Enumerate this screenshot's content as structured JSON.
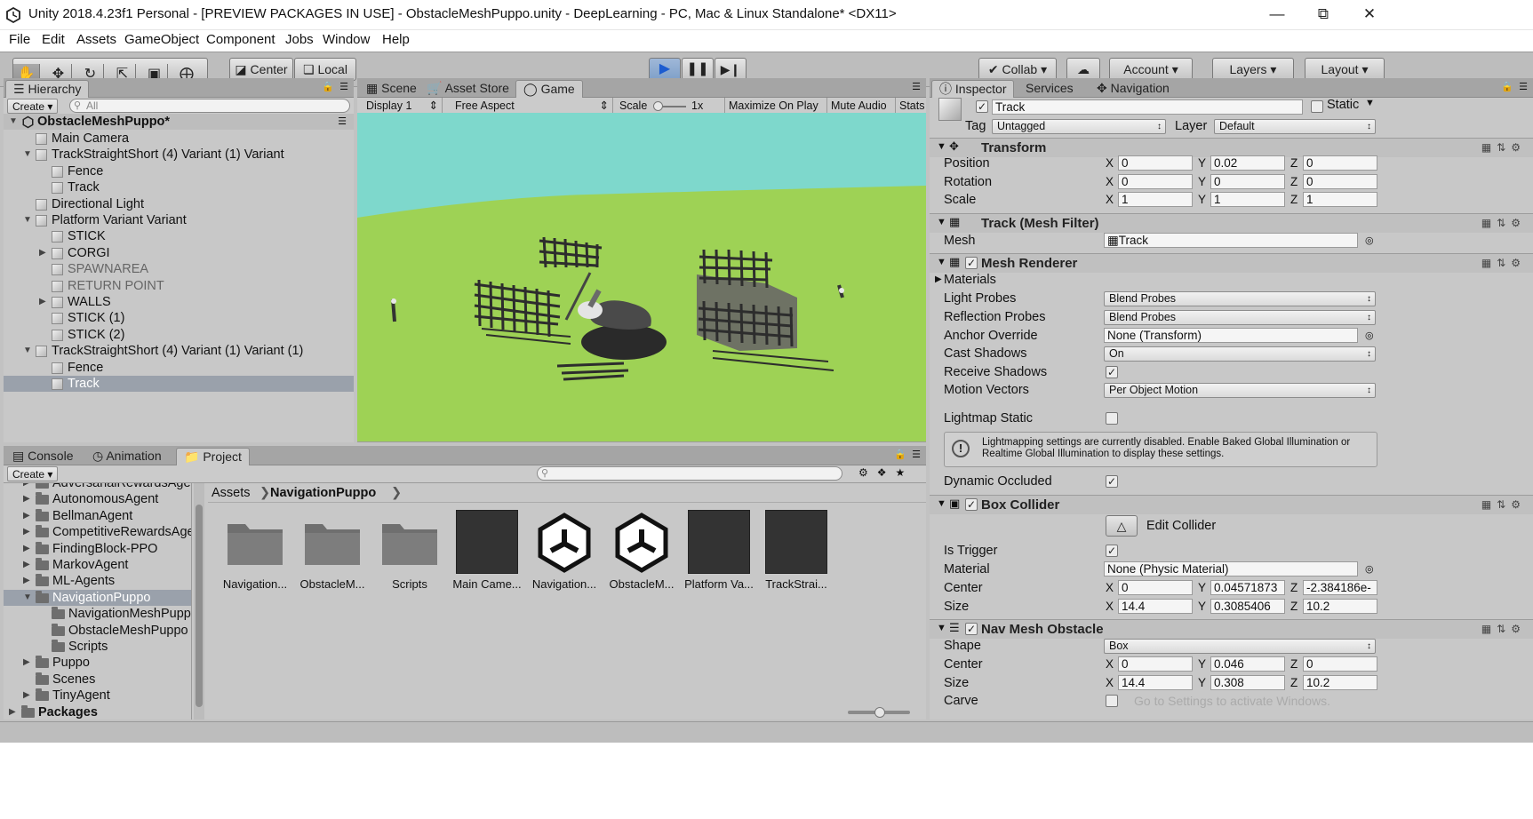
{
  "window": {
    "title": "Unity 2018.4.23f1 Personal - [PREVIEW PACKAGES IN USE] - ObstacleMeshPuppo.unity - DeepLearning - PC, Mac & Linux Standalone* <DX11>",
    "minimize": "—",
    "maximize": "⧉",
    "close": "✕"
  },
  "menu": [
    "File",
    "Edit",
    "Assets",
    "GameObject",
    "Component",
    "Jobs",
    "Window",
    "Help"
  ],
  "toolbar": {
    "tools": [
      "hand-icon",
      "move-icon",
      "rotate-icon",
      "scale-icon",
      "rect-icon",
      "transform-icon"
    ],
    "pivot": "Center",
    "space": "Local",
    "collab": "Collab",
    "account": "Account",
    "layers": "Layers",
    "layout": "Layout"
  },
  "hierarchy": {
    "tab": "Hierarchy",
    "create": "Create",
    "search_placeholder": "All",
    "scene_name": "ObstacleMeshPuppo*",
    "items": [
      {
        "label": "Main Camera",
        "depth": 1,
        "arrow": ""
      },
      {
        "label": "TrackStraightShort (4) Variant (1) Variant",
        "depth": 1,
        "arrow": "down"
      },
      {
        "label": "Fence",
        "depth": 2,
        "arrow": ""
      },
      {
        "label": "Track",
        "depth": 2,
        "arrow": ""
      },
      {
        "label": "Directional Light",
        "depth": 1,
        "arrow": ""
      },
      {
        "label": "Platform Variant Variant",
        "depth": 1,
        "arrow": "down"
      },
      {
        "label": "STICK",
        "depth": 2,
        "arrow": ""
      },
      {
        "label": "CORGI",
        "depth": 2,
        "arrow": "right"
      },
      {
        "label": "SPAWNAREA",
        "depth": 2,
        "arrow": "",
        "faded": true
      },
      {
        "label": "RETURN POINT",
        "depth": 2,
        "arrow": "",
        "faded": true
      },
      {
        "label": "WALLS",
        "depth": 2,
        "arrow": "right"
      },
      {
        "label": "STICK (1)",
        "depth": 2,
        "arrow": ""
      },
      {
        "label": "STICK (2)",
        "depth": 2,
        "arrow": ""
      },
      {
        "label": "TrackStraightShort (4) Variant (1) Variant (1)",
        "depth": 1,
        "arrow": "down"
      },
      {
        "label": "Fence",
        "depth": 2,
        "arrow": ""
      },
      {
        "label": "Track",
        "depth": 2,
        "arrow": "",
        "selected": true
      }
    ]
  },
  "view_tabs": {
    "scene": "Scene",
    "asset_store": "Asset Store",
    "game": "Game",
    "display": "Display 1",
    "aspect": "Free Aspect",
    "scale_label": "Scale",
    "scale_value": "1x",
    "maximize_on_play": "Maximize On Play",
    "mute_audio": "Mute Audio",
    "stats": "Stats"
  },
  "inspector": {
    "tabs": [
      "Inspector",
      "Services",
      "Navigation"
    ],
    "object_name": "Track",
    "static_label": "Static",
    "tag_label": "Tag",
    "tag_value": "Untagged",
    "layer_label": "Layer",
    "layer_value": "Default",
    "transform": {
      "title": "Transform",
      "position_label": "Position",
      "position": [
        "0",
        "0.02",
        "0"
      ],
      "rotation_label": "Rotation",
      "rotation": [
        "0",
        "0",
        "0"
      ],
      "scale_label": "Scale",
      "scale": [
        "1",
        "1",
        "1"
      ]
    },
    "mesh_filter": {
      "title": "Track (Mesh Filter)",
      "mesh_label": "Mesh",
      "mesh_value": "Track"
    },
    "mesh_renderer": {
      "title": "Mesh Renderer",
      "materials": "Materials",
      "light_probes_label": "Light Probes",
      "light_probes": "Blend Probes",
      "reflection_probes_label": "Reflection Probes",
      "reflection_probes": "Blend Probes",
      "anchor_override_label": "Anchor Override",
      "anchor_override": "None (Transform)",
      "cast_shadows_label": "Cast Shadows",
      "cast_shadows": "On",
      "receive_shadows_label": "Receive Shadows",
      "motion_vectors_label": "Motion Vectors",
      "motion_vectors": "Per Object Motion",
      "lightmap_static_label": "Lightmap Static",
      "info": "Lightmapping settings are currently disabled. Enable Baked Global Illumination or Realtime Global Illumination to display these settings.",
      "dynamic_occluded_label": "Dynamic Occluded"
    },
    "box_collider": {
      "title": "Box Collider",
      "edit_collider": "Edit Collider",
      "is_trigger_label": "Is Trigger",
      "material_label": "Material",
      "material": "None (Physic Material)",
      "center_label": "Center",
      "center": [
        "0",
        "0.04571873",
        "-2.384186e-"
      ],
      "size_label": "Size",
      "size": [
        "14.4",
        "0.3085406",
        "10.2"
      ]
    },
    "nav_mesh_obstacle": {
      "title": "Nav Mesh Obstacle",
      "shape_label": "Shape",
      "shape": "Box",
      "center_label": "Center",
      "center": [
        "0",
        "0.046",
        "0"
      ],
      "size_label": "Size",
      "size": [
        "14.4",
        "0.308",
        "10.2"
      ],
      "carve_label": "Carve"
    },
    "axes": [
      "X",
      "Y",
      "Z"
    ],
    "watermark": "Go to Settings to activate Windows."
  },
  "bottom_tabs": {
    "console": "Console",
    "animation": "Animation",
    "project": "Project"
  },
  "project": {
    "create": "Create",
    "tree": [
      {
        "label": "AdversarialRewardsAge",
        "depth": 1,
        "arrow": "right"
      },
      {
        "label": "AutonomousAgent",
        "depth": 1,
        "arrow": "right"
      },
      {
        "label": "BellmanAgent",
        "depth": 1,
        "arrow": "right"
      },
      {
        "label": "CompetitiveRewardsAge",
        "depth": 1,
        "arrow": "right"
      },
      {
        "label": "FindingBlock-PPO",
        "depth": 1,
        "arrow": "right"
      },
      {
        "label": "MarkovAgent",
        "depth": 1,
        "arrow": "right"
      },
      {
        "label": "ML-Agents",
        "depth": 1,
        "arrow": "right"
      },
      {
        "label": "NavigationPuppo",
        "depth": 1,
        "arrow": "down",
        "selected": true
      },
      {
        "label": "NavigationMeshPuppo",
        "depth": 2,
        "arrow": ""
      },
      {
        "label": "ObstacleMeshPuppo",
        "depth": 2,
        "arrow": ""
      },
      {
        "label": "Scripts",
        "depth": 2,
        "arrow": ""
      },
      {
        "label": "Puppo",
        "depth": 1,
        "arrow": "right"
      },
      {
        "label": "Scenes",
        "depth": 1,
        "arrow": ""
      },
      {
        "label": "TinyAgent",
        "depth": 1,
        "arrow": "right"
      },
      {
        "label": "Packages",
        "depth": 0,
        "arrow": "right",
        "bold": true
      }
    ],
    "breadcrumb": [
      "Assets",
      "NavigationPuppo"
    ],
    "assets": [
      {
        "label": "Navigation...",
        "kind": "folder"
      },
      {
        "label": "ObstacleM...",
        "kind": "folder"
      },
      {
        "label": "Scripts",
        "kind": "folder"
      },
      {
        "label": "Main Came...",
        "kind": "prefab-dark"
      },
      {
        "label": "Navigation...",
        "kind": "unity"
      },
      {
        "label": "ObstacleM...",
        "kind": "unity"
      },
      {
        "label": "Platform Va...",
        "kind": "prefab-dark"
      },
      {
        "label": "TrackStrai...",
        "kind": "prefab-dark"
      }
    ]
  },
  "colors": {
    "sky": "#7ed8cc",
    "ground": "#9ed255",
    "selection": "#9aa1ab",
    "editor_bg": "#c2c2c2"
  }
}
